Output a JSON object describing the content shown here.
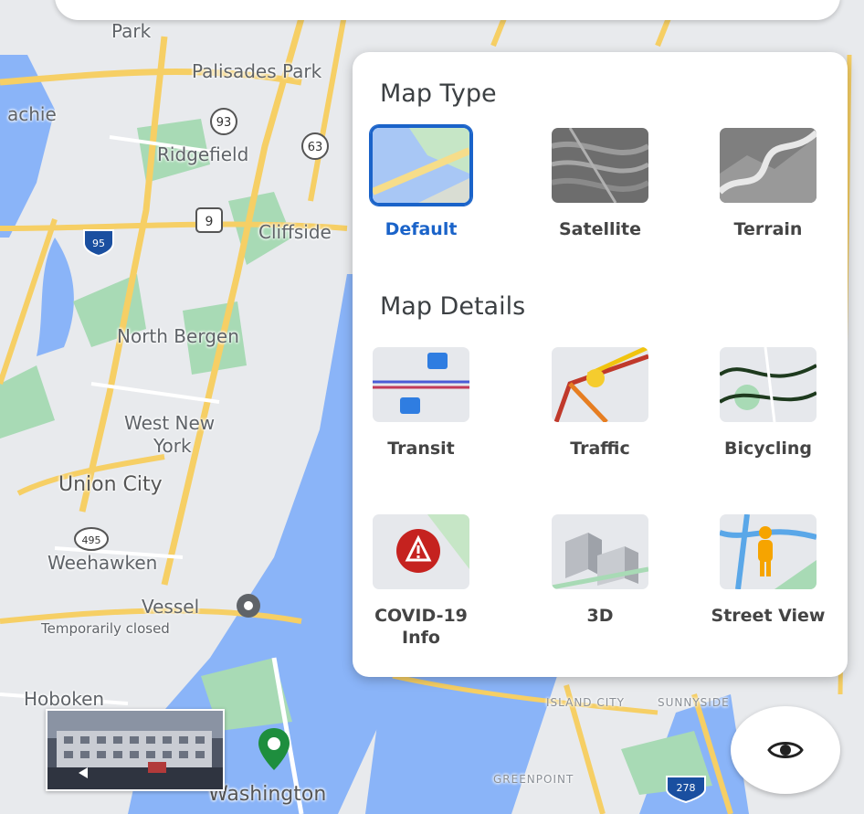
{
  "map_labels": {
    "park": "Park",
    "palisades_park": "Palisades Park",
    "achie": "achie",
    "ridgefield": "Ridgefield",
    "cliffside": "Cliffside",
    "north_bergen": "North Bergen",
    "west_new_york_1": "West New",
    "west_new_york_2": "York",
    "union_city": "Union City",
    "weehawken": "Weehawken",
    "vessel": "Vessel",
    "temporarily_closed": "Temporarily closed",
    "hoboken": "Hoboken",
    "washington": "Washington",
    "greenpoint": "GREENPOINT",
    "island_city": "ISLAND CITY",
    "sunnyside": "SUNNYSIDE",
    "route_93": "93",
    "route_63": "63",
    "route_9": "9",
    "route_95": "95",
    "route_495": "495",
    "route_278": "278"
  },
  "panel": {
    "map_type_title": "Map Type",
    "map_details_title": "Map Details",
    "map_types": [
      {
        "label": "Default",
        "selected": true
      },
      {
        "label": "Satellite",
        "selected": false
      },
      {
        "label": "Terrain",
        "selected": false
      }
    ],
    "map_details": [
      {
        "label": "Transit"
      },
      {
        "label": "Traffic"
      },
      {
        "label": "Bicycling"
      },
      {
        "label": "COVID-19 Info"
      },
      {
        "label": "3D"
      },
      {
        "label": "Street View"
      }
    ]
  },
  "colors": {
    "accent": "#1a63c9",
    "water": "#8ab4f8",
    "road": "#f6cf65",
    "park": "#a8dab5"
  }
}
